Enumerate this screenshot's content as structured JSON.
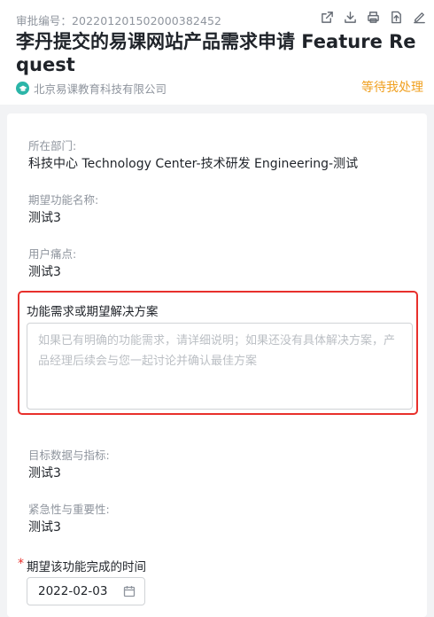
{
  "header": {
    "approval_no": "审批编号：202201201502000382452",
    "title": "李丹提交的易课网站产品需求申请 Feature Request",
    "company": "北京易课教育科技有限公司",
    "status": "等待我处理",
    "toolbar_icons": [
      "external-link-icon",
      "download-icon",
      "print-icon",
      "export-file-icon",
      "edit-icon"
    ]
  },
  "fields": [
    {
      "label": "所在部门:",
      "value": "科技中心 Technology Center-技术研发 Engineering-测试"
    },
    {
      "label": "期望功能名称:",
      "value": "测试3"
    },
    {
      "label": "用户痛点:",
      "value": "测试3"
    }
  ],
  "solution": {
    "label": "功能需求或期望解决方案",
    "placeholder": "如果已有明确的功能需求，请详细说明；如果还没有具体解决方案，产品经理后续会与您一起讨论并确认最佳方案",
    "value": ""
  },
  "fields_after": [
    {
      "label": "目标数据与指标:",
      "value": "测试3"
    },
    {
      "label": "紧急性与重要性:",
      "value": "测试3"
    }
  ],
  "completion_date": {
    "required_mark": "*",
    "label": "期望该功能完成的时间",
    "value": "2022-02-03"
  },
  "colors": {
    "status": "#f0a020",
    "highlight_border": "#e8302c",
    "company_logo": "#2bb5a8"
  }
}
